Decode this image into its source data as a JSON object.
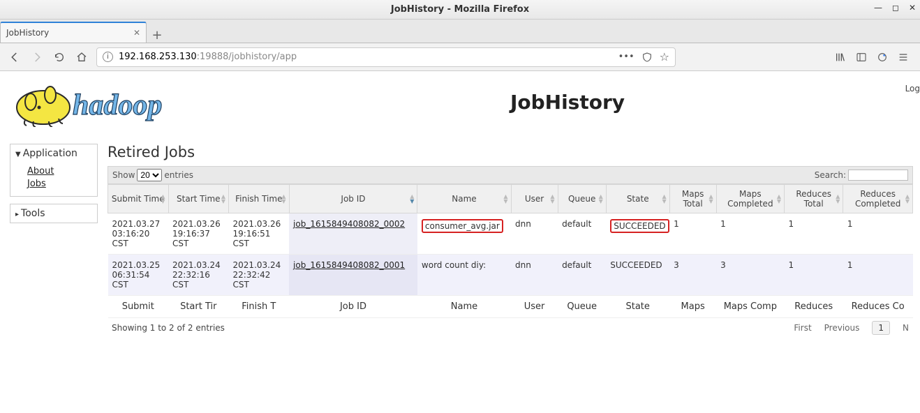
{
  "window": {
    "title": "JobHistory - Mozilla Firefox"
  },
  "tab": {
    "label": "JobHistory"
  },
  "url": {
    "ip": "192.168.253.130",
    "rest": ":19888/jobhistory/app"
  },
  "header": {
    "page_title": "JobHistory",
    "logged_in": "Log"
  },
  "sidebar": {
    "app": {
      "title": "Application",
      "items": [
        "About",
        "Jobs"
      ]
    },
    "tools": {
      "title": "Tools"
    }
  },
  "main": {
    "section_title": "Retired Jobs",
    "show_label": "Show",
    "show_value": "20",
    "entries_label": "entries",
    "search_label": "Search:"
  },
  "table": {
    "headers": [
      "Submit Time",
      "Start Time",
      "Finish Time",
      "Job ID",
      "Name",
      "User",
      "Queue",
      "State",
      "Maps Total",
      "Maps Completed",
      "Reduces Total",
      "Reduces Completed"
    ],
    "filter_labels": [
      "Submit",
      "Start Tir",
      "Finish T",
      "Job ID",
      "Name",
      "User",
      "Queue",
      "State",
      "Maps",
      "Maps Comp",
      "Reduces",
      "Reduces Co"
    ],
    "rows": [
      {
        "submit": "2021.03.27 03:16:20 CST",
        "start": "2021.03.26 19:16:37 CST",
        "finish": "2021.03.26 19:16:51 CST",
        "job_id": "job_1615849408082_0002",
        "name": "consumer_avg.jar",
        "user": "dnn",
        "queue": "default",
        "state": "SUCCEEDED",
        "maps_total": "1",
        "maps_completed": "1",
        "reduces_total": "1",
        "reduces_completed": "1",
        "highlight_name": true,
        "highlight_state": true
      },
      {
        "submit": "2021.03.25 06:31:54 CST",
        "start": "2021.03.24 22:32:16 CST",
        "finish": "2021.03.24 22:32:42 CST",
        "job_id": "job_1615849408082_0001",
        "name": "word count diy:",
        "user": "dnn",
        "queue": "default",
        "state": "SUCCEEDED",
        "maps_total": "3",
        "maps_completed": "3",
        "reduces_total": "1",
        "reduces_completed": "1",
        "highlight_name": false,
        "highlight_state": false
      }
    ]
  },
  "footer": {
    "info": "Showing 1 to 2 of 2 entries",
    "first": "First",
    "prev": "Previous",
    "page": "1",
    "next": "N"
  }
}
